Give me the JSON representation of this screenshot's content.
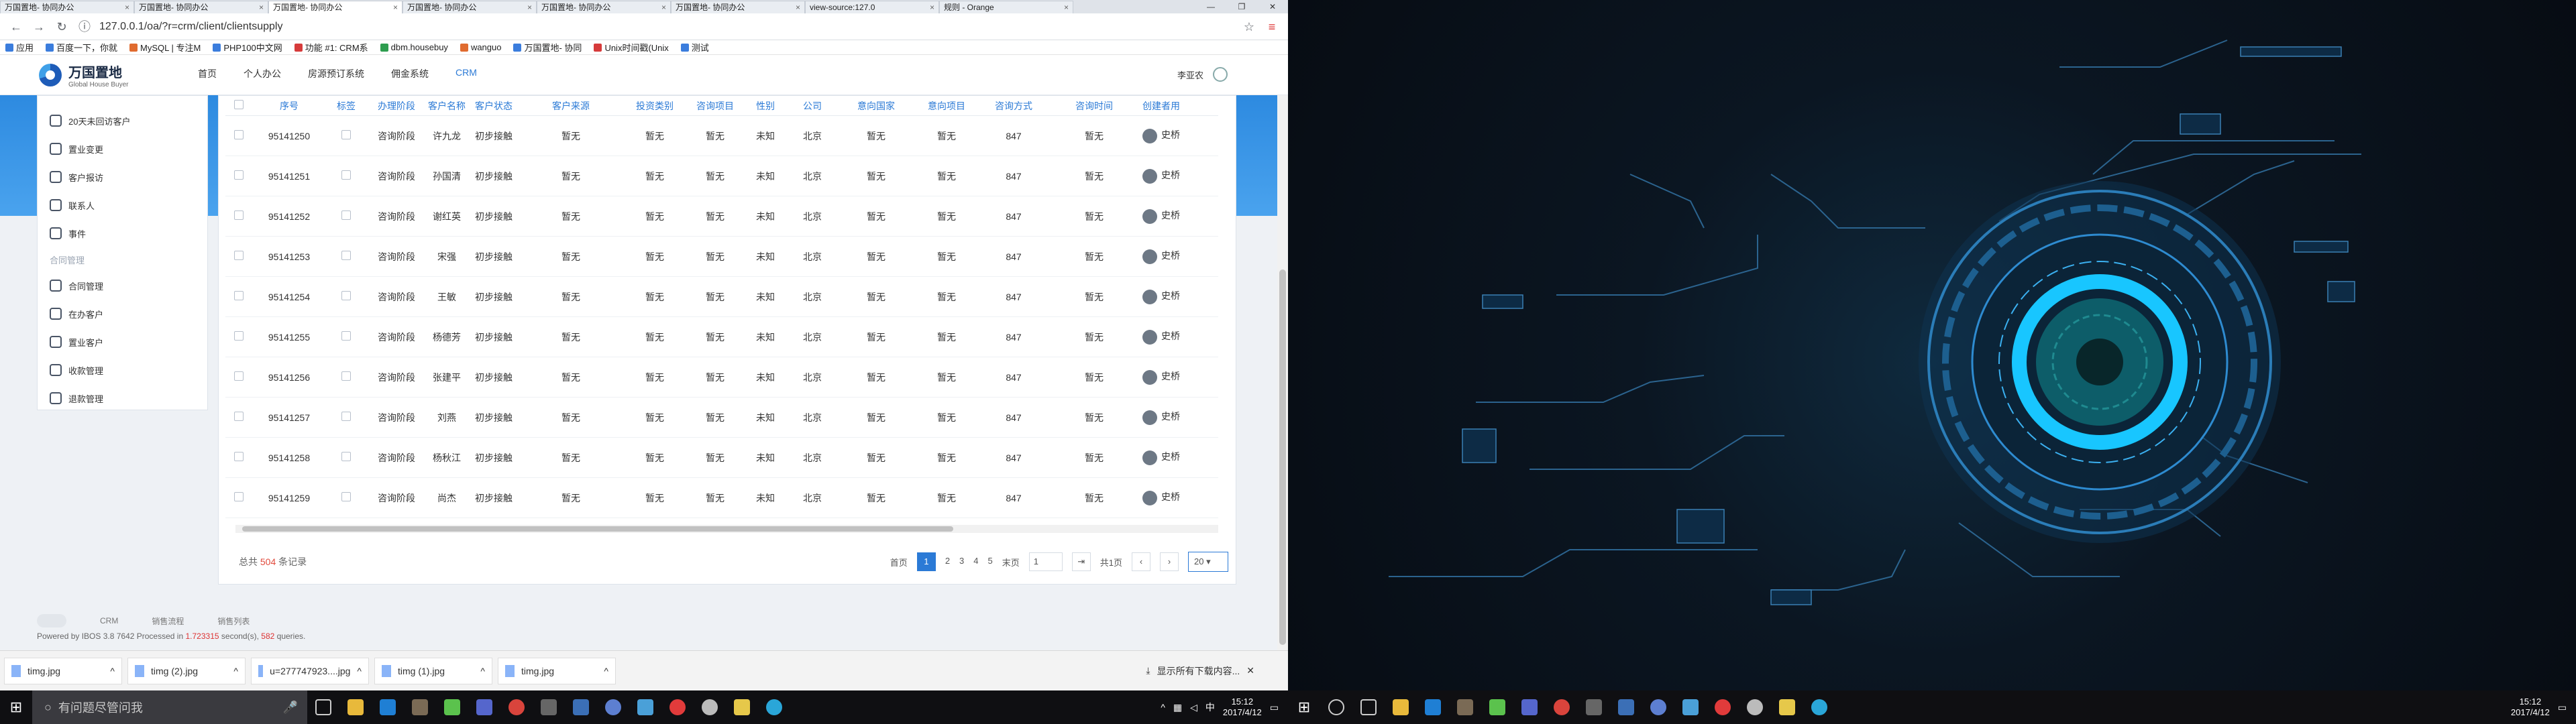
{
  "browser": {
    "tabs": [
      {
        "label": "万国置地- 协同办公"
      },
      {
        "label": "万国置地- 协同办公"
      },
      {
        "label": "万国置地- 协同办公"
      },
      {
        "label": "万国置地- 协同办公"
      },
      {
        "label": "万国置地- 协同办公"
      },
      {
        "label": "万国置地- 协同办公"
      },
      {
        "label": "view-source:127.0"
      },
      {
        "label": "规则 - Orange"
      }
    ],
    "url": "127.0.0.1/oa/?r=crm/client/clientsupply",
    "bookmarks": [
      "应用",
      "百度一下，你就",
      "MySQL | 专注M",
      "PHP100中文网",
      "功能 #1: CRM系",
      "dbm.housebuy",
      "wanguo",
      "万国置地- 协同",
      "Unix时间戳(Unix",
      "测试"
    ]
  },
  "app": {
    "logo_cn": "万国置地",
    "logo_en": "Global House Buyer",
    "nav": [
      "首页",
      "个人办公",
      "房源预订系统",
      "佣金系统",
      "CRM"
    ],
    "user": "李亚农"
  },
  "sidebar": {
    "items": [
      {
        "label": "20天未回访客户"
      },
      {
        "label": "置业变更"
      },
      {
        "label": "客户报访"
      },
      {
        "label": "联系人"
      },
      {
        "label": "事件"
      }
    ],
    "group_label": "合同管理",
    "group_items": [
      {
        "label": "合同管理"
      },
      {
        "label": "在办客户"
      },
      {
        "label": "置业客户"
      },
      {
        "label": "收款管理"
      },
      {
        "label": "退款管理"
      }
    ]
  },
  "table": {
    "headers": [
      "序号",
      "标签",
      "办理阶段",
      "客户名称",
      "客户状态",
      "客户来源",
      "投资类别",
      "咨询项目",
      "性别",
      "公司",
      "意向国家",
      "意向项目",
      "咨询方式",
      "咨询时间",
      "创建者用"
    ],
    "rows": [
      {
        "id": "95141250",
        "stage": "咨询阶段",
        "name": "许九龙",
        "status": "初步接触",
        "source": "暂无",
        "invest": "暂无",
        "proj": "暂无",
        "sex": "未知",
        "company": "北京",
        "country": "暂无",
        "intent": "暂无",
        "method": "847",
        "time": "暂无",
        "creator": "史桥"
      },
      {
        "id": "95141251",
        "stage": "咨询阶段",
        "name": "孙国清",
        "status": "初步接触",
        "source": "暂无",
        "invest": "暂无",
        "proj": "暂无",
        "sex": "未知",
        "company": "北京",
        "country": "暂无",
        "intent": "暂无",
        "method": "847",
        "time": "暂无",
        "creator": "史桥"
      },
      {
        "id": "95141252",
        "stage": "咨询阶段",
        "name": "谢红英",
        "status": "初步接触",
        "source": "暂无",
        "invest": "暂无",
        "proj": "暂无",
        "sex": "未知",
        "company": "北京",
        "country": "暂无",
        "intent": "暂无",
        "method": "847",
        "time": "暂无",
        "creator": "史桥"
      },
      {
        "id": "95141253",
        "stage": "咨询阶段",
        "name": "宋强",
        "status": "初步接触",
        "source": "暂无",
        "invest": "暂无",
        "proj": "暂无",
        "sex": "未知",
        "company": "北京",
        "country": "暂无",
        "intent": "暂无",
        "method": "847",
        "time": "暂无",
        "creator": "史桥"
      },
      {
        "id": "95141254",
        "stage": "咨询阶段",
        "name": "王敏",
        "status": "初步接触",
        "source": "暂无",
        "invest": "暂无",
        "proj": "暂无",
        "sex": "未知",
        "company": "北京",
        "country": "暂无",
        "intent": "暂无",
        "method": "847",
        "time": "暂无",
        "creator": "史桥"
      },
      {
        "id": "95141255",
        "stage": "咨询阶段",
        "name": "杨德芳",
        "status": "初步接触",
        "source": "暂无",
        "invest": "暂无",
        "proj": "暂无",
        "sex": "未知",
        "company": "北京",
        "country": "暂无",
        "intent": "暂无",
        "method": "847",
        "time": "暂无",
        "creator": "史桥"
      },
      {
        "id": "95141256",
        "stage": "咨询阶段",
        "name": "张建平",
        "status": "初步接触",
        "source": "暂无",
        "invest": "暂无",
        "proj": "暂无",
        "sex": "未知",
        "company": "北京",
        "country": "暂无",
        "intent": "暂无",
        "method": "847",
        "time": "暂无",
        "creator": "史桥"
      },
      {
        "id": "95141257",
        "stage": "咨询阶段",
        "name": "刘燕",
        "status": "初步接触",
        "source": "暂无",
        "invest": "暂无",
        "proj": "暂无",
        "sex": "未知",
        "company": "北京",
        "country": "暂无",
        "intent": "暂无",
        "method": "847",
        "time": "暂无",
        "creator": "史桥"
      },
      {
        "id": "95141258",
        "stage": "咨询阶段",
        "name": "杨秋江",
        "status": "初步接触",
        "source": "暂无",
        "invest": "暂无",
        "proj": "暂无",
        "sex": "未知",
        "company": "北京",
        "country": "暂无",
        "intent": "暂无",
        "method": "847",
        "time": "暂无",
        "creator": "史桥"
      },
      {
        "id": "95141259",
        "stage": "咨询阶段",
        "name": "尚杰",
        "status": "初步接触",
        "source": "暂无",
        "invest": "暂无",
        "proj": "暂无",
        "sex": "未知",
        "company": "北京",
        "country": "暂无",
        "intent": "暂无",
        "method": "847",
        "time": "暂无",
        "creator": "史桥"
      }
    ]
  },
  "pager": {
    "total_prefix": "总共",
    "total": "504",
    "total_suffix": "条记录",
    "first": "首页",
    "pages": [
      "1",
      "2",
      "3",
      "4",
      "5"
    ],
    "last": "末页",
    "page_input": "1",
    "page_count": "共1页",
    "page_size": "20"
  },
  "crumbs": [
    "CRM",
    "销售流程",
    "销售列表"
  ],
  "powered": {
    "prefix": "Powered by IBOS 3.8 7642 Processed in",
    "time": "1.723315",
    "mid": "second(s),",
    "queries": "582",
    "suffix": "queries."
  },
  "downloads": {
    "items": [
      "timg.jpg",
      "timg (2).jpg",
      "u=277747923....jpg",
      "timg (1).jpg",
      "timg.jpg"
    ],
    "show_all": "显示所有下载内容..."
  },
  "taskbar": {
    "search_placeholder": "有问题尽管问我",
    "time": "15:12",
    "date": "2017/4/12",
    "ime": "中"
  },
  "colors": {
    "accent": "#2b7ad6",
    "header_blue": "#3b96e8",
    "highlight_red": "#e14b3d"
  }
}
